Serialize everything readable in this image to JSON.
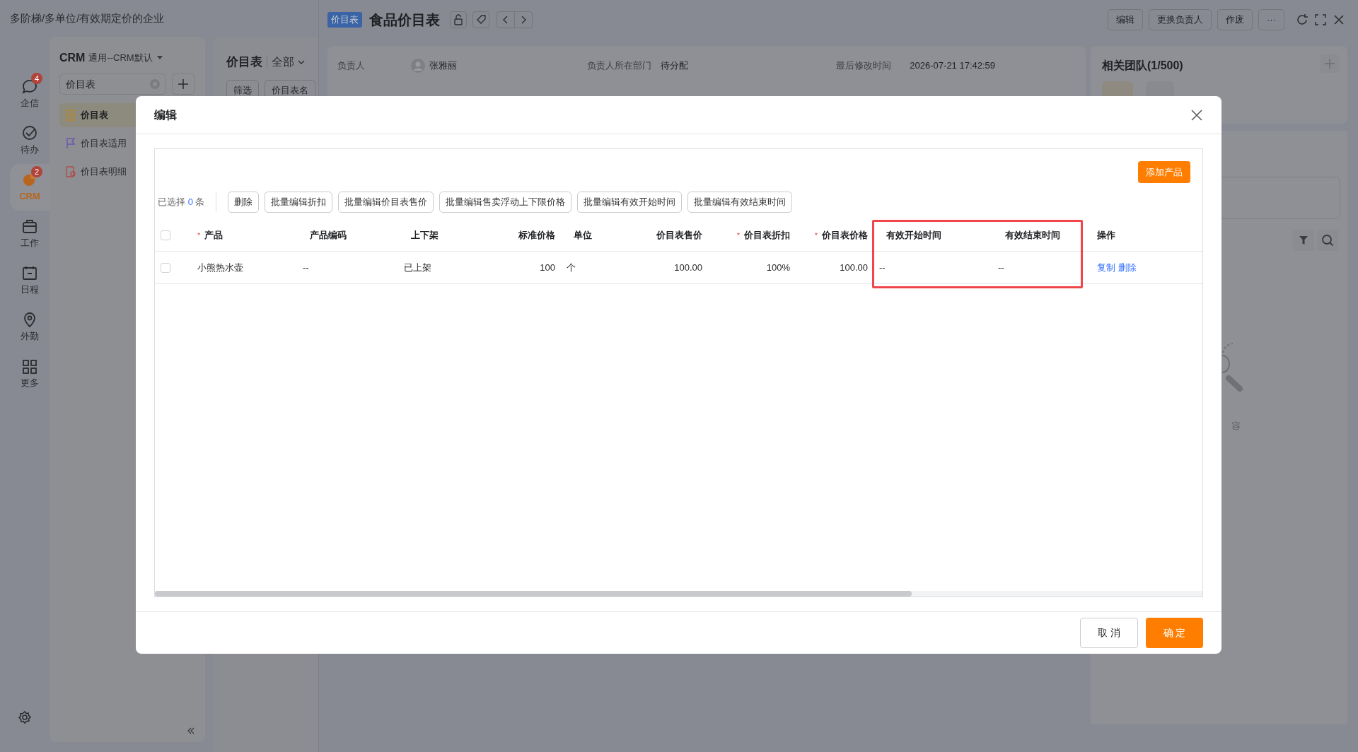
{
  "breadcrumb": "多阶梯/多单位/有效期定价的企业",
  "nav": [
    {
      "label": "企信",
      "badge": "4",
      "selected": false
    },
    {
      "label": "待办",
      "selected": false
    },
    {
      "label": "CRM",
      "badge": "2",
      "selected": true
    },
    {
      "label": "工作",
      "selected": false
    },
    {
      "label": "日程",
      "selected": false
    },
    {
      "label": "外勤",
      "selected": false
    },
    {
      "label": "更多",
      "selected": false
    }
  ],
  "app_panel": {
    "title": "CRM",
    "subtitle": "通用--CRM默认",
    "search_value": "价目表",
    "items": [
      {
        "label": "价目表",
        "selected": true
      },
      {
        "label": "价目表适用",
        "selected": false
      },
      {
        "label": "价目表明细",
        "selected": false
      }
    ]
  },
  "list_panel": {
    "title": "价目表",
    "scope": "全部",
    "buttons": [
      "筛选",
      "价目表名"
    ]
  },
  "detail": {
    "tag": "价目表",
    "title": "食品价目表",
    "actions": [
      "编辑",
      "更换负责人",
      "作废",
      "···"
    ],
    "fields": [
      {
        "label": "负责人",
        "value": "张雅丽",
        "kind": "person"
      },
      {
        "label": "负责人所在部门",
        "value": "待分配",
        "kind": "text"
      },
      {
        "label": "最后修改时间",
        "value": "2026-07-21 17:42:59",
        "kind": "text"
      }
    ]
  },
  "team": {
    "title": "相关团队(1/500)"
  },
  "empty_hint": "容",
  "modal": {
    "title": "编辑",
    "add_button": "添加产品",
    "selected_label": "已选择",
    "selected_count": "0",
    "selected_unit": "条",
    "bulk_buttons": [
      "删除",
      "批量编辑折扣",
      "批量编辑价目表售价",
      "批量编辑售卖浮动上下限价格",
      "批量编辑有效开始时间",
      "批量编辑有效结束时间"
    ],
    "all_selected": false,
    "columns": [
      {
        "label": "产品",
        "required_mark": "*",
        "kind": "text",
        "highlighted": false
      },
      {
        "label": "产品编码",
        "kind": "text",
        "highlighted": false
      },
      {
        "label": "上下架",
        "kind": "text",
        "highlighted": false
      },
      {
        "label": "标准价格",
        "kind": "number",
        "highlighted": false
      },
      {
        "label": "单位",
        "kind": "text",
        "highlighted": false
      },
      {
        "label": "价目表售价",
        "kind": "number",
        "highlighted": false
      },
      {
        "label": "价目表折扣",
        "required_mark": "*",
        "kind": "number",
        "highlighted": false
      },
      {
        "label": "价目表价格",
        "required_mark": "*",
        "kind": "number",
        "highlighted": false
      },
      {
        "label": "有效开始时间",
        "kind": "text",
        "highlighted": true
      },
      {
        "label": "有效结束时间",
        "kind": "text",
        "highlighted": true
      },
      {
        "label": "操作",
        "kind": "text",
        "highlighted": false
      }
    ],
    "rows": [
      {
        "selected": false,
        "cells": [
          "小熊热水壶",
          "--",
          "已上架",
          "100",
          "个",
          "100.00",
          "100%",
          "100.00",
          "--",
          "--"
        ],
        "actions": [
          "复制",
          "删除"
        ]
      }
    ],
    "cancel": "取 消",
    "confirm": "确 定"
  }
}
